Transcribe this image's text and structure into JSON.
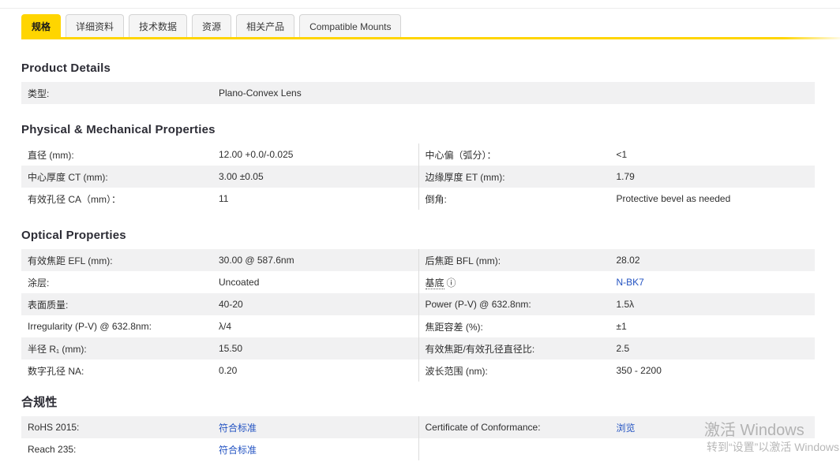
{
  "tabs": [
    "规格",
    "详细资料",
    "技术数据",
    "资源",
    "相关产品",
    "Compatible Mounts"
  ],
  "icons": {
    "info": "ⓘ"
  },
  "colors": {
    "accent_yellow": "#ffd500",
    "link_blue": "#2353c2",
    "row_shade": "#f1f1f2"
  },
  "product": {
    "title": "Product Details",
    "rows": [
      {
        "label": "类型:",
        "value": "Plano-Convex Lens"
      }
    ]
  },
  "physical": {
    "title": "Physical & Mechanical Properties",
    "rows": [
      {
        "l_label": "直径 (mm):",
        "l_value": "12.00 +0.0/-0.025",
        "r_label": "中心偏（弧分）：",
        "r_value": "<1"
      },
      {
        "l_label": "中心厚度 CT (mm):",
        "l_value": "3.00 ±0.05",
        "r_label": "边缘厚度 ET (mm):",
        "r_value": "1.79"
      },
      {
        "l_label": "有效孔径 CA（mm）：",
        "l_value": "11",
        "r_label": "倒角:",
        "r_value": "Protective bevel as needed"
      }
    ]
  },
  "optical": {
    "title": "Optical Properties",
    "rows": [
      {
        "l_label": "有效焦距 EFL (mm):",
        "l_value": "30.00 @ 587.6nm",
        "r_label": "后焦距 BFL (mm):",
        "r_value": "28.02"
      },
      {
        "l_label": "涂层:",
        "l_value": "Uncoated",
        "r_label": "基底",
        "r_value": "N-BK7"
      },
      {
        "l_label": "表面质量:",
        "l_value": "40-20",
        "r_label": "Power (P-V) @ 632.8nm:",
        "r_value": "1.5λ"
      },
      {
        "l_label": "Irregularity (P-V) @ 632.8nm:",
        "l_value": "λ/4",
        "r_label": "焦距容差 (%):",
        "r_value": "±1"
      },
      {
        "l_label": "半径 R₁ (mm):",
        "l_value": "15.50",
        "r_label": "有效焦距/有效孔径直径比:",
        "r_value": "2.5"
      },
      {
        "l_label": "数字孔径 NA:",
        "l_value": "0.20",
        "r_label": "波长范围 (nm):",
        "r_value": "350 - 2200"
      }
    ]
  },
  "compliance": {
    "title": "合规性",
    "rows": [
      {
        "l_label": "RoHS 2015:",
        "l_value": "符合标准",
        "r_label": "Certificate of Conformance:",
        "r_value": "浏览"
      },
      {
        "l_label": "Reach 235:",
        "l_value": "符合标准"
      }
    ]
  },
  "watermark": {
    "line1": "激活 Windows",
    "line2": "转到“设置”以激活 Windows"
  }
}
